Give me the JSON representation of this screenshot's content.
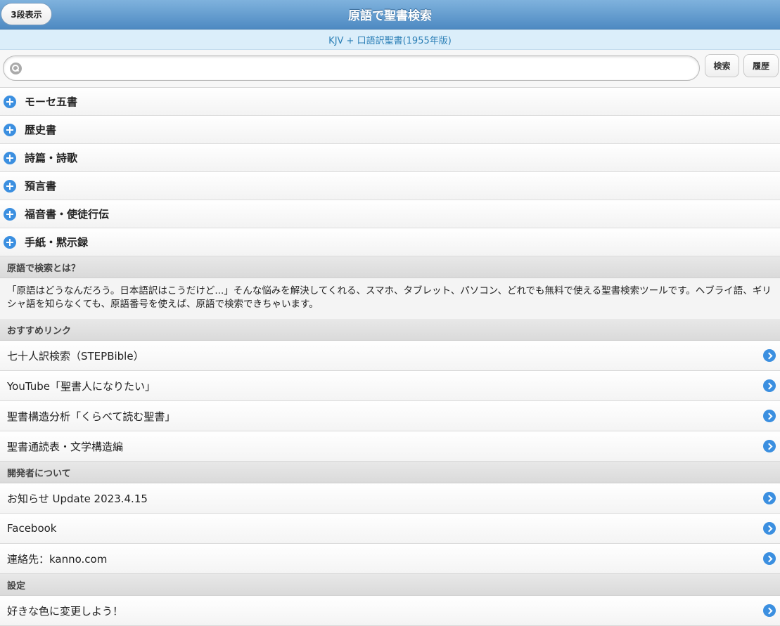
{
  "header": {
    "title": "原語で聖書検索",
    "mode_button": "3段表示"
  },
  "subheader": "KJV + 口語訳聖書(1955年版)",
  "search": {
    "placeholder": "",
    "search_button": "検索",
    "history_button": "履歴"
  },
  "categories": [
    "モーセ五書",
    "歴史書",
    "詩篇・詩歌",
    "預言書",
    "福音書・使徒行伝",
    "手紙・黙示録"
  ],
  "about": {
    "heading": "原語で検索とは？",
    "text": "「原語はどうなんだろう。日本語訳はこうだけど...」そんな悩みを解決してくれる、スマホ、タブレット、パソコン、どれでも無料で使える聖書検索ツールです。ヘブライ語、ギリシャ語を知らなくても、原語番号を使えば、原語で検索できちゃいます。"
  },
  "recommended": {
    "heading": "おすすめリンク",
    "links": [
      "七十人訳検索（STEPBible）",
      "YouTube「聖書人になりたい」",
      "聖書構造分析「くらべて読む聖書」",
      "聖書通読表・文学構造編"
    ]
  },
  "developer": {
    "heading": "開発者について",
    "links": [
      "お知らせ Update 2023.4.15",
      "Facebook",
      "連絡先：kanno.com"
    ]
  },
  "settings": {
    "heading": "設定",
    "links": [
      "好きな色に変更しよう！"
    ]
  },
  "colors": {
    "header": "#5b95cc",
    "accent": "#3b8fe0",
    "subheader_text": "#2b7fb6"
  }
}
